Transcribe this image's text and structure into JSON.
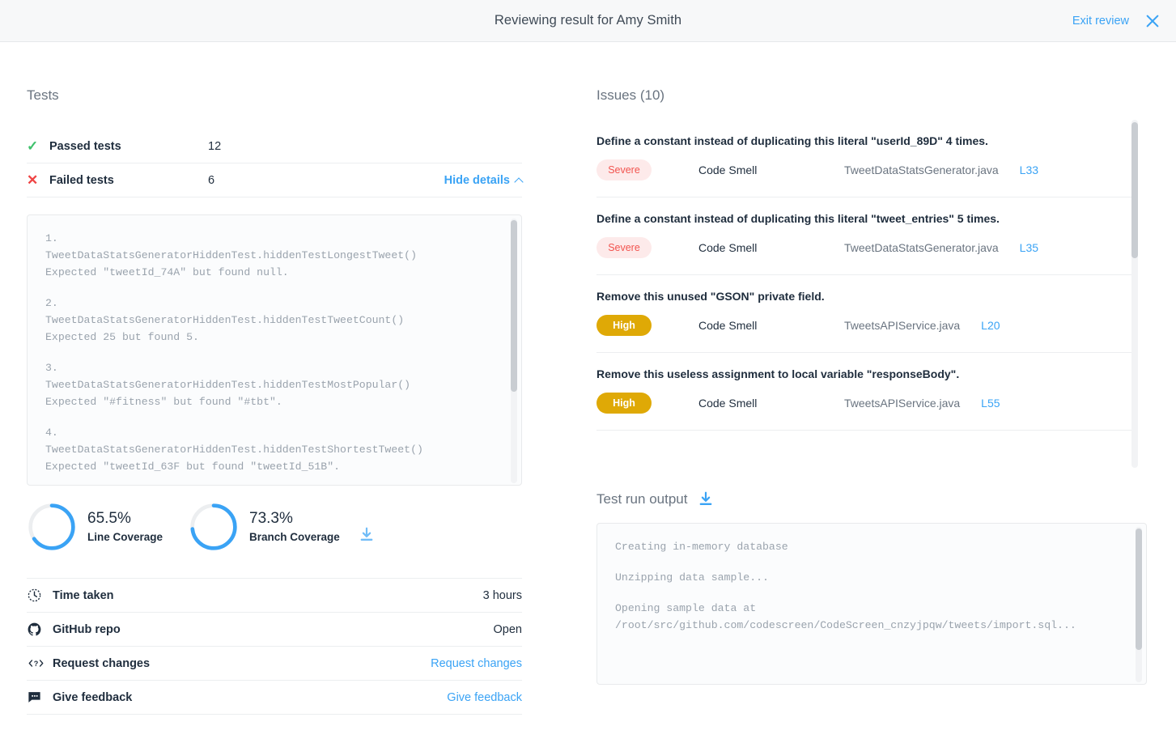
{
  "header": {
    "title": "Reviewing result for Amy Smith",
    "exit_label": "Exit review",
    "close_icon": "close-icon"
  },
  "tests": {
    "section_title": "Tests",
    "passed": {
      "label": "Passed tests",
      "value": "12",
      "icon": "check-icon"
    },
    "failed": {
      "label": "Failed tests",
      "value": "6",
      "icon": "x-icon"
    },
    "hide_details_label": "Hide details",
    "failures": [
      {
        "index": "1.",
        "test": "TweetDataStatsGeneratorHiddenTest.hiddenTestLongestTweet()",
        "detail": "Expected \"tweetId_74A\" but found null."
      },
      {
        "index": "2.",
        "test": "TweetDataStatsGeneratorHiddenTest.hiddenTestTweetCount()",
        "detail": "Expected 25 but found 5."
      },
      {
        "index": "3.",
        "test": "TweetDataStatsGeneratorHiddenTest.hiddenTestMostPopular()",
        "detail": "Expected \"#fitness\" but found \"#tbt\"."
      },
      {
        "index": "4.",
        "test": "TweetDataStatsGeneratorHiddenTest.hiddenTestShortestTweet()",
        "detail": "Expected \"tweetId_63F but found \"tweetId_51B\"."
      }
    ]
  },
  "coverage": [
    {
      "percent": "65.5%",
      "label": "Line Coverage",
      "value": 65.5
    },
    {
      "percent": "73.3%",
      "label": "Branch Coverage",
      "value": 73.3
    }
  ],
  "coverage_download_icon": "download-icon",
  "info_rows": [
    {
      "icon": "clock-icon",
      "label": "Time taken",
      "value": "3 hours",
      "link": false
    },
    {
      "icon": "github-icon",
      "label": "GitHub repo",
      "value": "Open",
      "link": false
    },
    {
      "icon": "code-question-icon",
      "label": "Request changes",
      "value": "Request changes",
      "link": true
    },
    {
      "icon": "speech-bubble-icon",
      "label": "Give feedback",
      "value": "Give feedback",
      "link": true
    }
  ],
  "issues": {
    "section_title": "Issues (10)",
    "count": 10,
    "items": [
      {
        "message": "Define a constant instead of duplicating this literal \"userId_89D\" 4 times.",
        "severity": "Severe",
        "severity_class": "severe",
        "type": "Code Smell",
        "file": "TweetDataStatsGenerator.java",
        "line": "L33"
      },
      {
        "message": "Define a constant instead of duplicating this literal \"tweet_entries\" 5 times.",
        "severity": "Severe",
        "severity_class": "severe",
        "type": "Code Smell",
        "file": "TweetDataStatsGenerator.java",
        "line": "L35"
      },
      {
        "message": "Remove this unused \"GSON\" private field.",
        "severity": "High",
        "severity_class": "high",
        "type": "Code Smell",
        "file": "TweetsAPIService.java",
        "line": "L20"
      },
      {
        "message": "Remove this useless assignment to local variable \"responseBody\".",
        "severity": "High",
        "severity_class": "high",
        "type": "Code Smell",
        "file": "TweetsAPIService.java",
        "line": "L55"
      }
    ]
  },
  "test_run_output": {
    "title": "Test run output",
    "download_icon": "download-icon",
    "lines": [
      "Creating in-memory database",
      "Unzipping data sample...",
      "Opening sample data at /root/src/github.com/codescreen/CodeScreen_cnzyjpqw/tweets/import.sql..."
    ]
  },
  "colors": {
    "accent": "#3aa3f5",
    "pass": "#3ec16b",
    "fail": "#ef4444",
    "severe_bg": "#fdeaea",
    "severe_fg": "#f2544f",
    "high_bg": "#dfa906",
    "text": "#1f2d3d",
    "muted": "#6a7480"
  }
}
